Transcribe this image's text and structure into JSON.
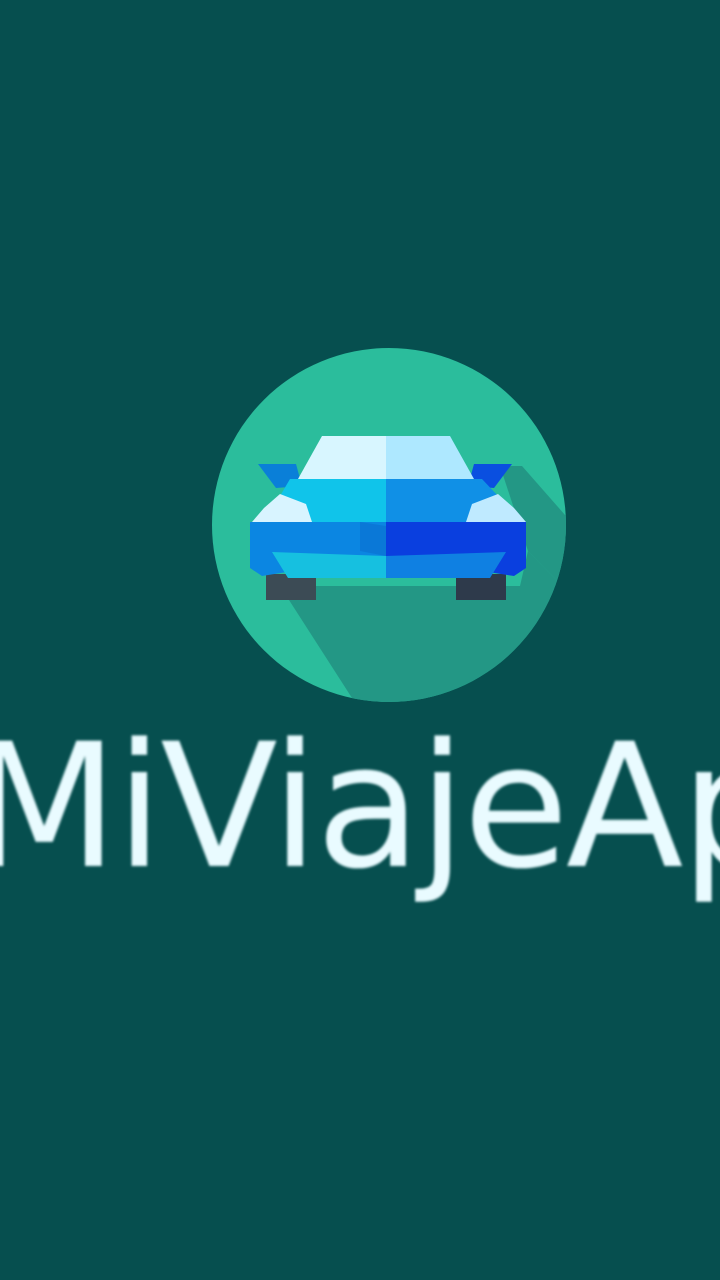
{
  "app": {
    "name": "MiViajeApp"
  },
  "logo": {
    "icon": "car-front-icon",
    "badge_color": "#2bbd9c",
    "shadow_color": "#229081",
    "background_color": "#064f4f"
  }
}
